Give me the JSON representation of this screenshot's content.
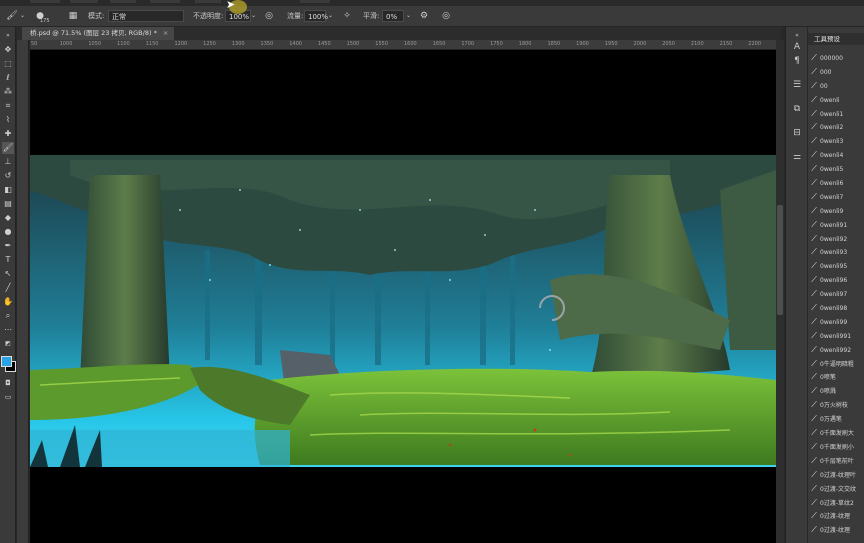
{
  "options_bar": {
    "brush_size": "175",
    "mode_label": "模式:",
    "mode_value": "正常",
    "opacity_label": "不透明度:",
    "opacity_value": "100%",
    "flow_label": "流量:",
    "flow_value": "100%",
    "smoothing_label": "平滑:",
    "smoothing_value": "0%"
  },
  "document_tab": {
    "title": "桥.psd @ 71.5% (图层 23 拷贝, RGB/8) *",
    "close": "×"
  },
  "ruler": {
    "ticks": [
      "50",
      "1000",
      "1050",
      "1100",
      "1150",
      "1200",
      "1250",
      "1300",
      "1350",
      "1400",
      "1450",
      "1500",
      "1550",
      "1600",
      "1650",
      "1700",
      "1750",
      "1800",
      "1850",
      "1900",
      "1950",
      "2000",
      "2050",
      "2100",
      "2150",
      "2200"
    ]
  },
  "panel": {
    "title": "工具预设",
    "items": [
      "000000",
      "000",
      "00",
      "0wenli",
      "0wenli1",
      "0wenli2",
      "0wenli3",
      "0wenli4",
      "0wenli5",
      "0wenli6",
      "0wenli7",
      "0wenli9",
      "0wenli91",
      "0wenli92",
      "0wenli93",
      "0wenli95",
      "0wenli96",
      "0wenli97",
      "0wenli98",
      "0wenli99",
      "0wenli991",
      "0wenli992",
      "0牛逼明暗粗",
      "0喷笔",
      "0喷溅",
      "0万火树枝",
      "0万遇笔",
      "0千面发刷大",
      "0千面发刷小",
      "0千层笔前叶",
      "0过渡-纹理叶",
      "0过渡-文交纹",
      "0过渡-草纹2",
      "0过渡-纹理",
      "0过渡-纹理"
    ]
  },
  "colors": {
    "foreground": "#29a3e6",
    "background": "#000000"
  }
}
